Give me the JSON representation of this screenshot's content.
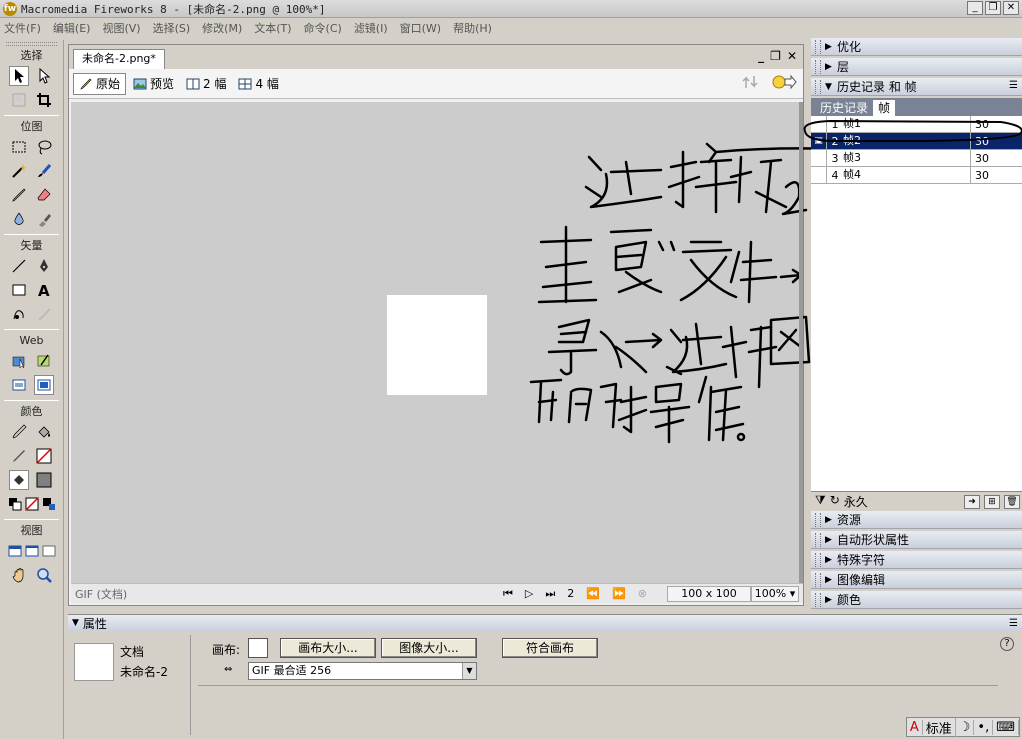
{
  "window": {
    "logo_glyph": "fw",
    "title": "Macromedia Fireworks 8 - [未命名-2.png @ 100%*]",
    "controls": [
      "_",
      "❐",
      "✕"
    ]
  },
  "menubar": {
    "items": [
      "文件(F)",
      "编辑(E)",
      "视图(V)",
      "选择(S)",
      "修改(M)",
      "文本(T)",
      "命令(C)",
      "滤镜(I)",
      "窗口(W)",
      "帮助(H)"
    ]
  },
  "toolbox": {
    "sections": {
      "select": "选择",
      "bitmap": "位图",
      "vector": "矢量",
      "web": "Web",
      "color": "颜色",
      "view": "视图"
    }
  },
  "document": {
    "tab_title": "未命名-2.png*",
    "controls": [
      "_",
      "❐",
      "✕"
    ],
    "view_tabs": [
      "原始",
      "预览",
      "2 幅",
      "4 幅"
    ],
    "active_view": "原始",
    "format": "GIF (文档)",
    "current_frame": "2",
    "size": "100 x 100",
    "zoom": "100%",
    "canvas_color": "#ffffff",
    "pasteboard_color": "#cccccc"
  },
  "panels": {
    "optimize": "优化",
    "layers": "层",
    "history_frames": "历史记录 和 帧",
    "tabs": [
      "历史记录",
      "帧"
    ],
    "active_tab": "帧",
    "frames": [
      {
        "num": "1",
        "name": "帧1",
        "delay": "30",
        "selected": false
      },
      {
        "num": "2",
        "name": "帧2",
        "delay": "30",
        "selected": true
      },
      {
        "num": "3",
        "name": "帧3",
        "delay": "30",
        "selected": false
      },
      {
        "num": "4",
        "name": "帧4",
        "delay": "30",
        "selected": false
      }
    ],
    "loop": "永久",
    "collapsed": [
      "资源",
      "自动形状属性",
      "特殊字符",
      "图像编辑",
      "颜色"
    ]
  },
  "properties": {
    "title": "属性",
    "doc_label": "文档",
    "doc_name": "未命名-2",
    "canvas_label": "画布:",
    "canvas_size_btn": "画布大小...",
    "image_size_btn": "图像大小...",
    "fit_canvas_btn": "符合画布",
    "optimize_value": "GIF 最合适 256",
    "help": "?"
  },
  "ime": [
    "A",
    "标准",
    "☽",
    "•,",
    "⌨"
  ],
  "selection_color": "#0a246a"
}
